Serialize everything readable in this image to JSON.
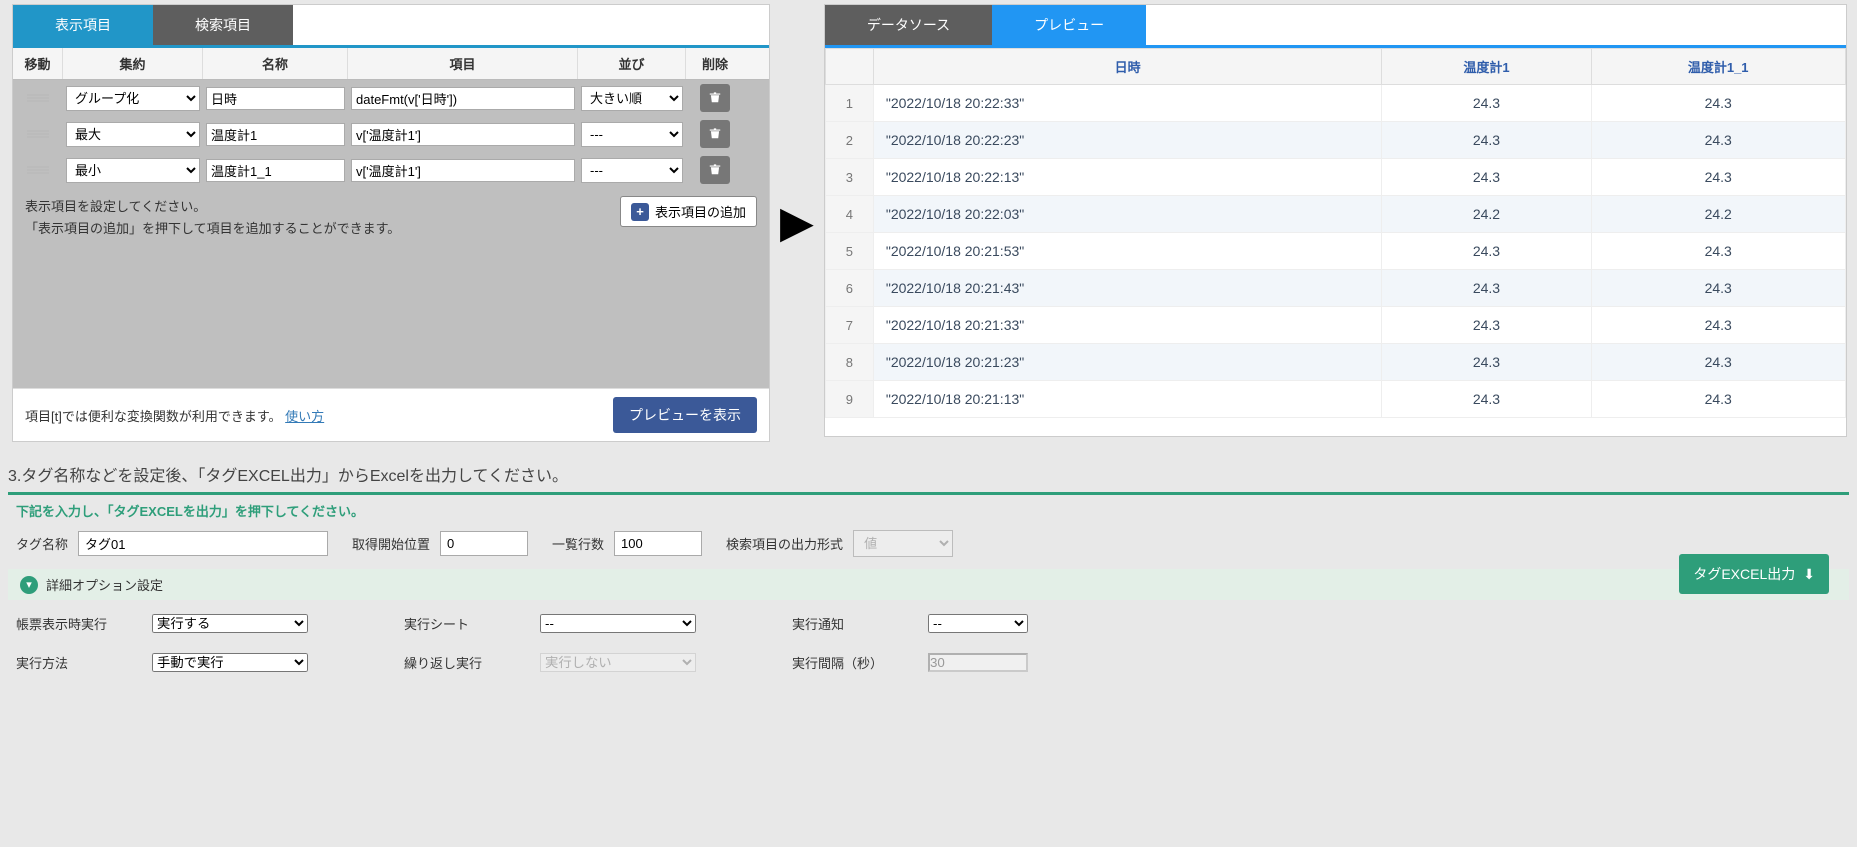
{
  "tabs_left": {
    "display": "表示項目",
    "search": "検索項目"
  },
  "tabs_right": {
    "datasource": "データソース",
    "preview": "プレビュー"
  },
  "grid": {
    "headers": {
      "move": "移動",
      "agg": "集約",
      "name": "名称",
      "item": "項目",
      "sort": "並び",
      "del": "削除"
    },
    "rows": [
      {
        "agg": "グループ化",
        "name": "日時",
        "item": "dateFmt(v['日時'])",
        "sort": "大きい順"
      },
      {
        "agg": "最大",
        "name": "温度計1",
        "item": "v['温度計1']",
        "sort": "---"
      },
      {
        "agg": "最小",
        "name": "温度計1_1",
        "item": "v['温度計1']",
        "sort": "---"
      }
    ],
    "agg_options": [
      "グループ化",
      "最大",
      "最小"
    ],
    "sort_options": [
      "大きい順",
      "---"
    ],
    "hint1": "表示項目を設定してください。",
    "hint2": "「表示項目の追加」を押下して項目を追加することができます。",
    "add_label": "表示項目の追加"
  },
  "footer": {
    "note": "項目[t]では便利な変換関数が利用できます。",
    "link": "使い方",
    "preview_btn": "プレビューを表示"
  },
  "preview": {
    "columns": [
      "日時",
      "温度計1",
      "温度計1_1"
    ],
    "rows": [
      {
        "n": "1",
        "dt": "\"2022/10/18 20:22:33\"",
        "v1": "24.3",
        "v2": "24.3"
      },
      {
        "n": "2",
        "dt": "\"2022/10/18 20:22:23\"",
        "v1": "24.3",
        "v2": "24.3"
      },
      {
        "n": "3",
        "dt": "\"2022/10/18 20:22:13\"",
        "v1": "24.3",
        "v2": "24.3"
      },
      {
        "n": "4",
        "dt": "\"2022/10/18 20:22:03\"",
        "v1": "24.2",
        "v2": "24.2"
      },
      {
        "n": "5",
        "dt": "\"2022/10/18 20:21:53\"",
        "v1": "24.3",
        "v2": "24.3"
      },
      {
        "n": "6",
        "dt": "\"2022/10/18 20:21:43\"",
        "v1": "24.3",
        "v2": "24.3"
      },
      {
        "n": "7",
        "dt": "\"2022/10/18 20:21:33\"",
        "v1": "24.3",
        "v2": "24.3"
      },
      {
        "n": "8",
        "dt": "\"2022/10/18 20:21:23\"",
        "v1": "24.3",
        "v2": "24.3"
      },
      {
        "n": "9",
        "dt": "\"2022/10/18 20:21:13\"",
        "v1": "24.3",
        "v2": "24.3"
      }
    ]
  },
  "section3": {
    "title": "3.タグ名称などを設定後、「タグEXCEL出力」からExcelを出力してください。",
    "instr": "下記を入力し、「タグEXCELを出力」を押下してください。",
    "labels": {
      "tag_name": "タグ名称",
      "start_pos": "取得開始位置",
      "list_rows": "一覧行数",
      "search_fmt": "検索項目の出力形式"
    },
    "values": {
      "tag_name": "タグ01",
      "start_pos": "0",
      "list_rows": "100",
      "search_fmt": "値"
    },
    "adv_title": "詳細オプション設定",
    "adv": {
      "exec_on_display": "帳票表示時実行",
      "exec_sheet": "実行シート",
      "exec_notify": "実行通知",
      "exec_method": "実行方法",
      "repeat_exec": "繰り返し実行",
      "exec_interval": "実行間隔（秒）"
    },
    "adv_values": {
      "exec_on_display": "実行する",
      "exec_sheet": "--",
      "exec_notify": "--",
      "exec_method": "手動で実行",
      "repeat_exec": "実行しない",
      "exec_interval": "30"
    },
    "export_btn": "タグEXCEL出力"
  }
}
